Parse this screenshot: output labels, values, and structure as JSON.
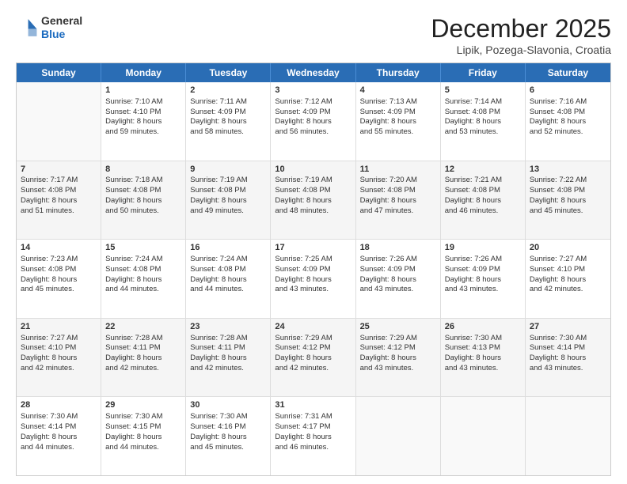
{
  "header": {
    "logo_general": "General",
    "logo_blue": "Blue",
    "month_year": "December 2025",
    "location": "Lipik, Pozega-Slavonia, Croatia"
  },
  "days_of_week": [
    "Sunday",
    "Monday",
    "Tuesday",
    "Wednesday",
    "Thursday",
    "Friday",
    "Saturday"
  ],
  "weeks": [
    [
      {
        "day": "",
        "info": ""
      },
      {
        "day": "1",
        "info": "Sunrise: 7:10 AM\nSunset: 4:10 PM\nDaylight: 8 hours\nand 59 minutes."
      },
      {
        "day": "2",
        "info": "Sunrise: 7:11 AM\nSunset: 4:09 PM\nDaylight: 8 hours\nand 58 minutes."
      },
      {
        "day": "3",
        "info": "Sunrise: 7:12 AM\nSunset: 4:09 PM\nDaylight: 8 hours\nand 56 minutes."
      },
      {
        "day": "4",
        "info": "Sunrise: 7:13 AM\nSunset: 4:09 PM\nDaylight: 8 hours\nand 55 minutes."
      },
      {
        "day": "5",
        "info": "Sunrise: 7:14 AM\nSunset: 4:08 PM\nDaylight: 8 hours\nand 53 minutes."
      },
      {
        "day": "6",
        "info": "Sunrise: 7:16 AM\nSunset: 4:08 PM\nDaylight: 8 hours\nand 52 minutes."
      }
    ],
    [
      {
        "day": "7",
        "info": "Sunrise: 7:17 AM\nSunset: 4:08 PM\nDaylight: 8 hours\nand 51 minutes."
      },
      {
        "day": "8",
        "info": "Sunrise: 7:18 AM\nSunset: 4:08 PM\nDaylight: 8 hours\nand 50 minutes."
      },
      {
        "day": "9",
        "info": "Sunrise: 7:19 AM\nSunset: 4:08 PM\nDaylight: 8 hours\nand 49 minutes."
      },
      {
        "day": "10",
        "info": "Sunrise: 7:19 AM\nSunset: 4:08 PM\nDaylight: 8 hours\nand 48 minutes."
      },
      {
        "day": "11",
        "info": "Sunrise: 7:20 AM\nSunset: 4:08 PM\nDaylight: 8 hours\nand 47 minutes."
      },
      {
        "day": "12",
        "info": "Sunrise: 7:21 AM\nSunset: 4:08 PM\nDaylight: 8 hours\nand 46 minutes."
      },
      {
        "day": "13",
        "info": "Sunrise: 7:22 AM\nSunset: 4:08 PM\nDaylight: 8 hours\nand 45 minutes."
      }
    ],
    [
      {
        "day": "14",
        "info": "Sunrise: 7:23 AM\nSunset: 4:08 PM\nDaylight: 8 hours\nand 45 minutes."
      },
      {
        "day": "15",
        "info": "Sunrise: 7:24 AM\nSunset: 4:08 PM\nDaylight: 8 hours\nand 44 minutes."
      },
      {
        "day": "16",
        "info": "Sunrise: 7:24 AM\nSunset: 4:08 PM\nDaylight: 8 hours\nand 44 minutes."
      },
      {
        "day": "17",
        "info": "Sunrise: 7:25 AM\nSunset: 4:09 PM\nDaylight: 8 hours\nand 43 minutes."
      },
      {
        "day": "18",
        "info": "Sunrise: 7:26 AM\nSunset: 4:09 PM\nDaylight: 8 hours\nand 43 minutes."
      },
      {
        "day": "19",
        "info": "Sunrise: 7:26 AM\nSunset: 4:09 PM\nDaylight: 8 hours\nand 43 minutes."
      },
      {
        "day": "20",
        "info": "Sunrise: 7:27 AM\nSunset: 4:10 PM\nDaylight: 8 hours\nand 42 minutes."
      }
    ],
    [
      {
        "day": "21",
        "info": "Sunrise: 7:27 AM\nSunset: 4:10 PM\nDaylight: 8 hours\nand 42 minutes."
      },
      {
        "day": "22",
        "info": "Sunrise: 7:28 AM\nSunset: 4:11 PM\nDaylight: 8 hours\nand 42 minutes."
      },
      {
        "day": "23",
        "info": "Sunrise: 7:28 AM\nSunset: 4:11 PM\nDaylight: 8 hours\nand 42 minutes."
      },
      {
        "day": "24",
        "info": "Sunrise: 7:29 AM\nSunset: 4:12 PM\nDaylight: 8 hours\nand 42 minutes."
      },
      {
        "day": "25",
        "info": "Sunrise: 7:29 AM\nSunset: 4:12 PM\nDaylight: 8 hours\nand 43 minutes."
      },
      {
        "day": "26",
        "info": "Sunrise: 7:30 AM\nSunset: 4:13 PM\nDaylight: 8 hours\nand 43 minutes."
      },
      {
        "day": "27",
        "info": "Sunrise: 7:30 AM\nSunset: 4:14 PM\nDaylight: 8 hours\nand 43 minutes."
      }
    ],
    [
      {
        "day": "28",
        "info": "Sunrise: 7:30 AM\nSunset: 4:14 PM\nDaylight: 8 hours\nand 44 minutes."
      },
      {
        "day": "29",
        "info": "Sunrise: 7:30 AM\nSunset: 4:15 PM\nDaylight: 8 hours\nand 44 minutes."
      },
      {
        "day": "30",
        "info": "Sunrise: 7:30 AM\nSunset: 4:16 PM\nDaylight: 8 hours\nand 45 minutes."
      },
      {
        "day": "31",
        "info": "Sunrise: 7:31 AM\nSunset: 4:17 PM\nDaylight: 8 hours\nand 46 minutes."
      },
      {
        "day": "",
        "info": ""
      },
      {
        "day": "",
        "info": ""
      },
      {
        "day": "",
        "info": ""
      }
    ]
  ]
}
